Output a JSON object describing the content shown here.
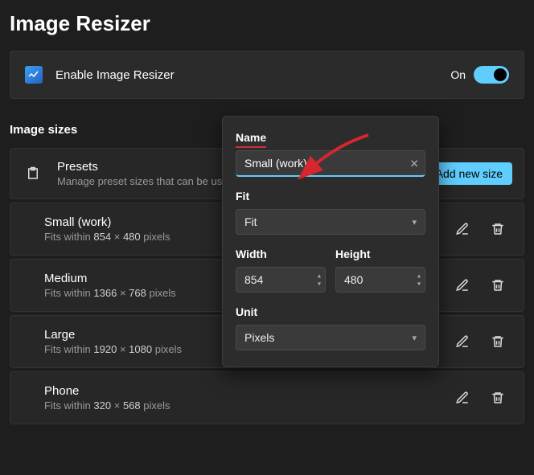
{
  "pageTitle": "Image Resizer",
  "enable": {
    "label": "Enable Image Resizer",
    "state": "On"
  },
  "section": "Image sizes",
  "presets": {
    "title": "Presets",
    "sub": "Manage preset sizes that can be used i",
    "addLabel": "Add new size"
  },
  "sizes": [
    {
      "name": "Small (work)",
      "prefix": "Fits within",
      "w": "854",
      "h": "480",
      "unit": "pixels"
    },
    {
      "name": "Medium",
      "prefix": "Fits within",
      "w": "1366",
      "h": "768",
      "unit": "pixels"
    },
    {
      "name": "Large",
      "prefix": "Fits within",
      "w": "1920",
      "h": "1080",
      "unit": "pixels"
    },
    {
      "name": "Phone",
      "prefix": "Fits within",
      "w": "320",
      "h": "568",
      "unit": "pixels"
    }
  ],
  "popup": {
    "nameLabel": "Name",
    "nameValue": "Small (work)",
    "fitLabel": "Fit",
    "fitValue": "Fit",
    "widthLabel": "Width",
    "widthValue": "854",
    "heightLabel": "Height",
    "heightValue": "480",
    "unitLabel": "Unit",
    "unitValue": "Pixels"
  }
}
